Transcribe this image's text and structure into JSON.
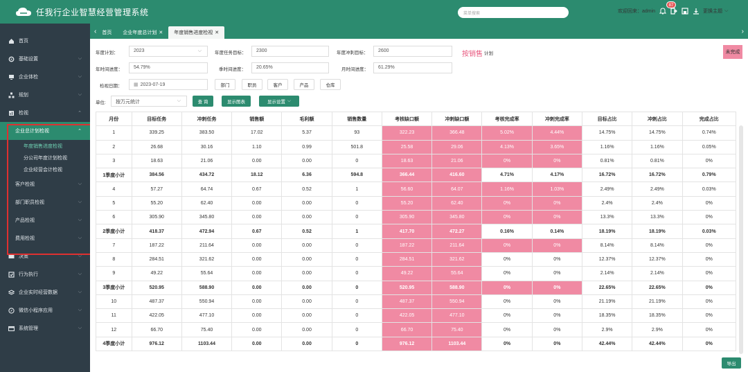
{
  "app": {
    "title": "任我行企业智慧经营管理系统",
    "search_placeholder": "菜单搜索",
    "welcome": "欢迎回来：admin",
    "badge": "87",
    "theme": "更换主题"
  },
  "sidebar": {
    "items": [
      {
        "label": "首页"
      },
      {
        "label": "基础设置"
      },
      {
        "label": "企业体检"
      },
      {
        "label": "规划"
      },
      {
        "label": "检视"
      }
    ],
    "subs": [
      {
        "label": "企业总计划检视",
        "active": true
      },
      {
        "label": "客户检视"
      },
      {
        "label": "部门职员检视"
      },
      {
        "label": "产品检视"
      },
      {
        "label": "费用检视"
      }
    ],
    "leaves": [
      {
        "label": "年度销售进度检视",
        "active": true
      },
      {
        "label": "分公司年度计划检视"
      },
      {
        "label": "企业经营会计检视"
      }
    ],
    "bottom": [
      {
        "label": "决策"
      },
      {
        "label": "行为执行"
      },
      {
        "label": "企业实时经营数据"
      },
      {
        "label": "微信小程序应用"
      },
      {
        "label": "系统管理"
      }
    ]
  },
  "tabs": [
    {
      "label": "首页"
    },
    {
      "label": "企业年度总计划"
    },
    {
      "label": "年度销售进度检视"
    }
  ],
  "filters": {
    "year_label": "年度计划：",
    "year_value": "2023",
    "task_label": "年度任务目标：",
    "task_value": "2300",
    "sprint_label": "年度冲刺目标：",
    "sprint_value": "2600",
    "by_sales": "按销售",
    "plan": "计划",
    "half_label": "年时间进度：",
    "half_value": "54.79%",
    "quarter_label": "季时间进度：",
    "quarter_value": "20.65%",
    "month_label": "月时间进度：",
    "month_value": "61.29%",
    "date_label": "检视日期：",
    "date_value": "2023-07-19",
    "btn_dept": "部门",
    "btn_staff": "职员",
    "btn_customer": "客户",
    "btn_product": "产品",
    "btn_warehouse": "仓库",
    "unit_label": "单位:",
    "unit_value": "按万元统计",
    "query": "查 询",
    "show_chart": "显示图表",
    "display_settings": "显示设置",
    "incomplete": "未完成"
  },
  "table": {
    "headers": [
      "月份",
      "目标任务",
      "冲刺任务",
      "销售额",
      "毛利额",
      "销售数量",
      "考核缺口额",
      "冲刺缺口额",
      "考核完成率",
      "冲刺完成率",
      "目标占比",
      "冲刺占比",
      "完成占比"
    ],
    "rows": [
      {
        "c": [
          "1",
          "339.25",
          "383.50",
          "17.02",
          "5.37",
          "93",
          "322.23",
          "366.48",
          "5.02%",
          "4.44%",
          "14.75%",
          "14.75%",
          "0.74%"
        ],
        "sub": false,
        "pink": [
          6,
          7,
          8,
          9
        ]
      },
      {
        "c": [
          "2",
          "26.68",
          "30.16",
          "1.10",
          "0.99",
          "501.8",
          "25.58",
          "29.06",
          "4.13%",
          "3.65%",
          "1.16%",
          "1.16%",
          "0.05%"
        ],
        "sub": false,
        "pink": [
          6,
          7,
          8,
          9
        ]
      },
      {
        "c": [
          "3",
          "18.63",
          "21.06",
          "0.00",
          "0.00",
          "0",
          "18.63",
          "21.06",
          "0%",
          "0%",
          "0.81%",
          "0.81%",
          "0%"
        ],
        "sub": false,
        "pink": [
          6,
          7,
          8,
          9
        ]
      },
      {
        "c": [
          "1季度小计",
          "384.56",
          "434.72",
          "18.12",
          "6.36",
          "594.8",
          "366.44",
          "416.60",
          "4.71%",
          "4.17%",
          "16.72%",
          "16.72%",
          "0.79%"
        ],
        "sub": true,
        "pink": [
          6,
          7
        ]
      },
      {
        "c": [
          "4",
          "57.27",
          "64.74",
          "0.67",
          "0.52",
          "1",
          "56.60",
          "64.07",
          "1.16%",
          "1.03%",
          "2.49%",
          "2.49%",
          "0.03%"
        ],
        "sub": false,
        "pink": [
          6,
          7,
          8,
          9
        ]
      },
      {
        "c": [
          "5",
          "55.20",
          "62.40",
          "0.00",
          "0.00",
          "0",
          "55.20",
          "62.40",
          "0%",
          "0%",
          "2.4%",
          "2.4%",
          "0%"
        ],
        "sub": false,
        "pink": [
          6,
          7,
          8,
          9
        ]
      },
      {
        "c": [
          "6",
          "305.90",
          "345.80",
          "0.00",
          "0.00",
          "0",
          "305.90",
          "345.80",
          "0%",
          "0%",
          "13.3%",
          "13.3%",
          "0%"
        ],
        "sub": false,
        "pink": [
          6,
          7,
          8,
          9
        ]
      },
      {
        "c": [
          "2季度小计",
          "418.37",
          "472.94",
          "0.67",
          "0.52",
          "1",
          "417.70",
          "472.27",
          "0.16%",
          "0.14%",
          "18.19%",
          "18.19%",
          "0.03%"
        ],
        "sub": true,
        "pink": [
          6,
          7
        ]
      },
      {
        "c": [
          "7",
          "187.22",
          "211.64",
          "0.00",
          "0.00",
          "0",
          "187.22",
          "211.64",
          "0%",
          "0%",
          "8.14%",
          "8.14%",
          "0%"
        ],
        "sub": false,
        "pink": [
          6,
          7,
          8,
          9
        ]
      },
      {
        "c": [
          "8",
          "284.51",
          "321.62",
          "0.00",
          "0.00",
          "0",
          "284.51",
          "321.62",
          "0%",
          "0%",
          "12.37%",
          "12.37%",
          "0%"
        ],
        "sub": false,
        "pink": [
          6,
          7
        ]
      },
      {
        "c": [
          "9",
          "49.22",
          "55.64",
          "0.00",
          "0.00",
          "0",
          "49.22",
          "55.64",
          "0%",
          "0%",
          "2.14%",
          "2.14%",
          "0%"
        ],
        "sub": false,
        "pink": [
          6,
          7
        ]
      },
      {
        "c": [
          "3季度小计",
          "520.95",
          "588.90",
          "0.00",
          "0.00",
          "0",
          "520.95",
          "588.90",
          "0%",
          "0%",
          "22.65%",
          "22.65%",
          "0%"
        ],
        "sub": true,
        "pink": [
          6,
          7,
          8,
          9
        ]
      },
      {
        "c": [
          "10",
          "487.37",
          "550.94",
          "0.00",
          "0.00",
          "0",
          "487.37",
          "550.94",
          "0%",
          "0%",
          "21.19%",
          "21.19%",
          "0%"
        ],
        "sub": false,
        "pink": [
          6,
          7
        ]
      },
      {
        "c": [
          "11",
          "422.05",
          "477.10",
          "0.00",
          "0.00",
          "0",
          "422.05",
          "477.10",
          "0%",
          "0%",
          "18.35%",
          "18.35%",
          "0%"
        ],
        "sub": false,
        "pink": [
          6,
          7
        ]
      },
      {
        "c": [
          "12",
          "66.70",
          "75.40",
          "0.00",
          "0.00",
          "0",
          "66.70",
          "75.40",
          "0%",
          "0%",
          "2.9%",
          "2.9%",
          "0%"
        ],
        "sub": false,
        "pink": [
          6,
          7
        ]
      },
      {
        "c": [
          "4季度小计",
          "976.12",
          "1103.44",
          "0.00",
          "0.00",
          "0",
          "976.12",
          "1103.44",
          "0%",
          "0%",
          "42.44%",
          "42.44%",
          "0%"
        ],
        "sub": true,
        "pink": [
          6,
          7
        ]
      }
    ]
  },
  "export": "导出",
  "colors": {
    "primary": "#2c8b6f",
    "sidebar": "#2f3d47",
    "pink": "#f08aa3",
    "highlight_box": "#e03030"
  }
}
